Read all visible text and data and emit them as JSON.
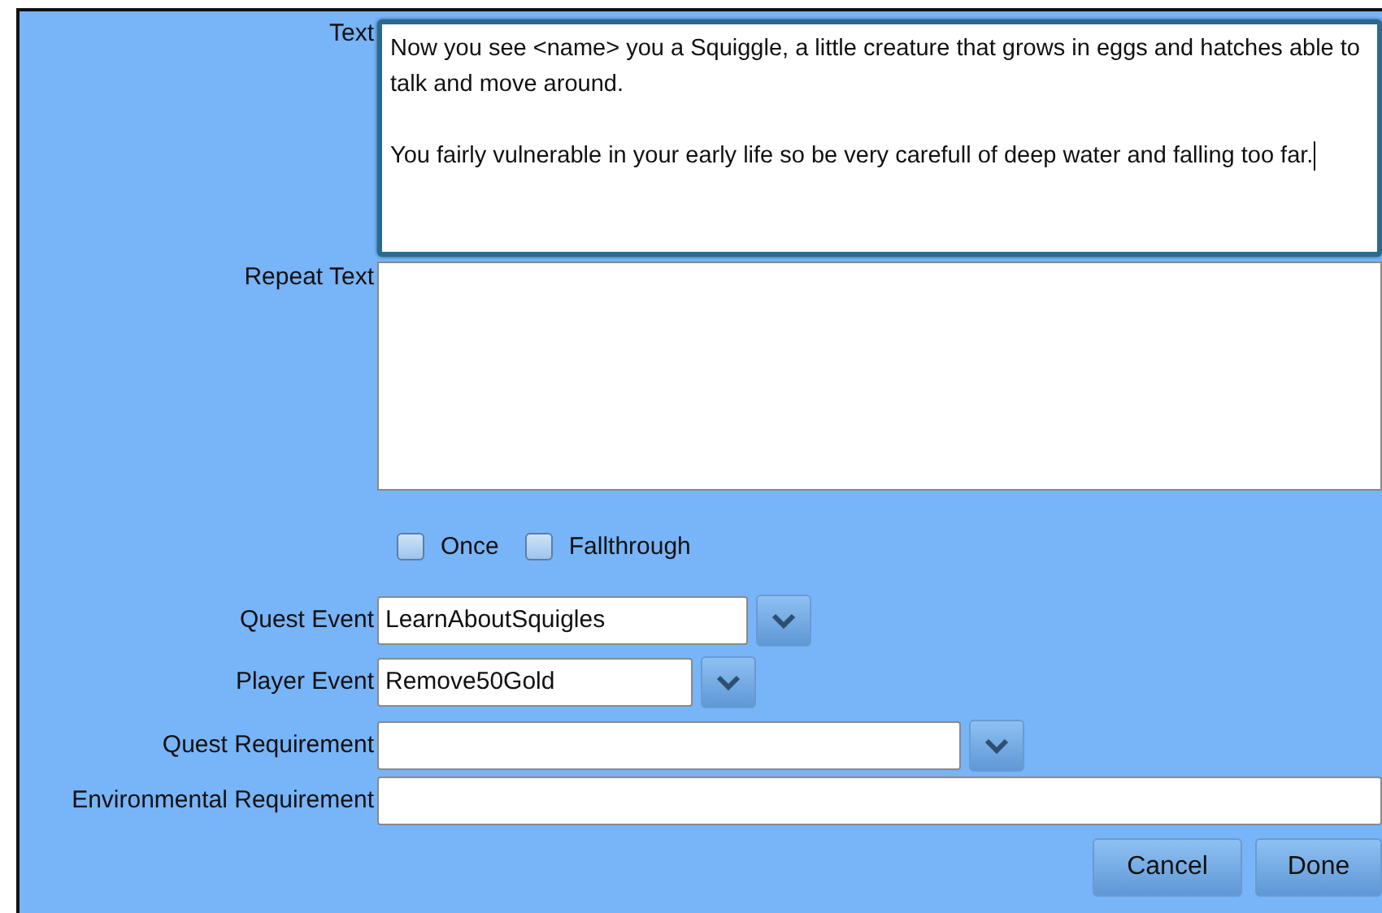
{
  "text_field": {
    "label": "Text",
    "value": "Now you see <name> you a Squiggle, a little creature that grows in eggs and hatches able to talk and move around.\n\nYou fairly vulnerable in your early life so be very carefull of deep water and falling too far.",
    "focused": true
  },
  "repeat_text_field": {
    "label": "Repeat Text"
  },
  "checkboxes": [
    {
      "label": "Once",
      "checked": false
    },
    {
      "label": "Fallthrough",
      "checked": false
    }
  ],
  "fields": [
    {
      "kind": "combo",
      "label": "Quest Event",
      "value": "LearnAboutSquigles"
    },
    {
      "kind": "combo",
      "label": "Player Event",
      "value": "Remove50Gold"
    },
    {
      "kind": "combo",
      "label": "Quest Requirement"
    },
    {
      "kind": "text",
      "label": "Environmental Requirement"
    }
  ],
  "buttons": [
    "Cancel",
    "Done"
  ]
}
